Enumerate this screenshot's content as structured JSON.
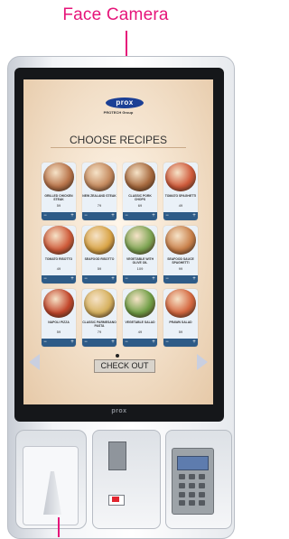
{
  "annotation": {
    "label": "Face Camera",
    "color": "#e6157a"
  },
  "screen": {
    "brand": "prox",
    "brand_sub": "PROTECH Group",
    "title": "CHOOSE RECIPES",
    "checkout_label": "CHECK OUT",
    "recipes": [
      {
        "name": "GRILLED CHICKEN STEAK",
        "price": "59",
        "color": "#b9744a"
      },
      {
        "name": "NEW ZEALAND STEAK",
        "price": "79",
        "color": "#c58a5e"
      },
      {
        "name": "CLASSIC PORK CHOPS",
        "price": "69",
        "color": "#a86a3e"
      },
      {
        "name": "TOMATO SPAGHETTI",
        "price": "49",
        "color": "#d05a3a"
      },
      {
        "name": "TOMATO RISOTTO",
        "price": "49",
        "color": "#cf5b3a"
      },
      {
        "name": "SEAFOOD RISOTTO",
        "price": "59",
        "color": "#d9a446"
      },
      {
        "name": "VEGETABLE WITH OLIVE OIL",
        "price": "109",
        "color": "#7da452"
      },
      {
        "name": "SEAFOOD SAUCE SPAGHETTI",
        "price": "99",
        "color": "#c9804a"
      },
      {
        "name": "NAPOLI PIZZA",
        "price": "59",
        "color": "#c3472c"
      },
      {
        "name": "CLASSIC PARMESANO PASTA",
        "price": "79",
        "color": "#d6b15e"
      },
      {
        "name": "VEGETABLE SALAD",
        "price": "49",
        "color": "#6f9e45"
      },
      {
        "name": "PRAWN SALAD",
        "price": "59",
        "color": "#d5673f"
      }
    ],
    "qty_minus": "−",
    "qty_plus": "+"
  },
  "kiosk": {
    "bezel_logo": "prox"
  }
}
